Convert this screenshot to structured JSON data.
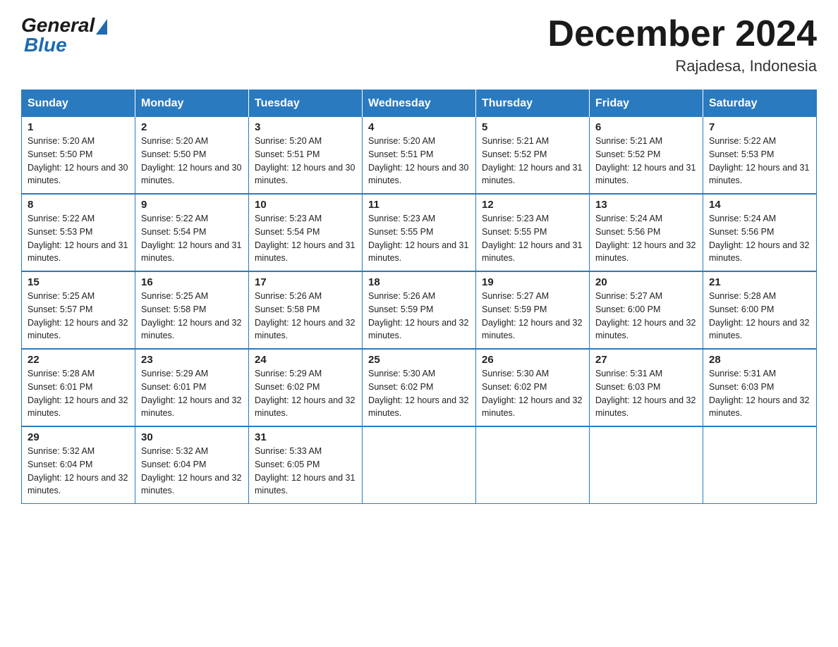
{
  "header": {
    "logo_general": "General",
    "logo_blue": "Blue",
    "month_title": "December 2024",
    "location": "Rajadesa, Indonesia"
  },
  "calendar": {
    "days_of_week": [
      "Sunday",
      "Monday",
      "Tuesday",
      "Wednesday",
      "Thursday",
      "Friday",
      "Saturday"
    ],
    "weeks": [
      [
        {
          "day": "1",
          "sunrise": "5:20 AM",
          "sunset": "5:50 PM",
          "daylight": "12 hours and 30 minutes."
        },
        {
          "day": "2",
          "sunrise": "5:20 AM",
          "sunset": "5:50 PM",
          "daylight": "12 hours and 30 minutes."
        },
        {
          "day": "3",
          "sunrise": "5:20 AM",
          "sunset": "5:51 PM",
          "daylight": "12 hours and 30 minutes."
        },
        {
          "day": "4",
          "sunrise": "5:20 AM",
          "sunset": "5:51 PM",
          "daylight": "12 hours and 30 minutes."
        },
        {
          "day": "5",
          "sunrise": "5:21 AM",
          "sunset": "5:52 PM",
          "daylight": "12 hours and 31 minutes."
        },
        {
          "day": "6",
          "sunrise": "5:21 AM",
          "sunset": "5:52 PM",
          "daylight": "12 hours and 31 minutes."
        },
        {
          "day": "7",
          "sunrise": "5:22 AM",
          "sunset": "5:53 PM",
          "daylight": "12 hours and 31 minutes."
        }
      ],
      [
        {
          "day": "8",
          "sunrise": "5:22 AM",
          "sunset": "5:53 PM",
          "daylight": "12 hours and 31 minutes."
        },
        {
          "day": "9",
          "sunrise": "5:22 AM",
          "sunset": "5:54 PM",
          "daylight": "12 hours and 31 minutes."
        },
        {
          "day": "10",
          "sunrise": "5:23 AM",
          "sunset": "5:54 PM",
          "daylight": "12 hours and 31 minutes."
        },
        {
          "day": "11",
          "sunrise": "5:23 AM",
          "sunset": "5:55 PM",
          "daylight": "12 hours and 31 minutes."
        },
        {
          "day": "12",
          "sunrise": "5:23 AM",
          "sunset": "5:55 PM",
          "daylight": "12 hours and 31 minutes."
        },
        {
          "day": "13",
          "sunrise": "5:24 AM",
          "sunset": "5:56 PM",
          "daylight": "12 hours and 32 minutes."
        },
        {
          "day": "14",
          "sunrise": "5:24 AM",
          "sunset": "5:56 PM",
          "daylight": "12 hours and 32 minutes."
        }
      ],
      [
        {
          "day": "15",
          "sunrise": "5:25 AM",
          "sunset": "5:57 PM",
          "daylight": "12 hours and 32 minutes."
        },
        {
          "day": "16",
          "sunrise": "5:25 AM",
          "sunset": "5:58 PM",
          "daylight": "12 hours and 32 minutes."
        },
        {
          "day": "17",
          "sunrise": "5:26 AM",
          "sunset": "5:58 PM",
          "daylight": "12 hours and 32 minutes."
        },
        {
          "day": "18",
          "sunrise": "5:26 AM",
          "sunset": "5:59 PM",
          "daylight": "12 hours and 32 minutes."
        },
        {
          "day": "19",
          "sunrise": "5:27 AM",
          "sunset": "5:59 PM",
          "daylight": "12 hours and 32 minutes."
        },
        {
          "day": "20",
          "sunrise": "5:27 AM",
          "sunset": "6:00 PM",
          "daylight": "12 hours and 32 minutes."
        },
        {
          "day": "21",
          "sunrise": "5:28 AM",
          "sunset": "6:00 PM",
          "daylight": "12 hours and 32 minutes."
        }
      ],
      [
        {
          "day": "22",
          "sunrise": "5:28 AM",
          "sunset": "6:01 PM",
          "daylight": "12 hours and 32 minutes."
        },
        {
          "day": "23",
          "sunrise": "5:29 AM",
          "sunset": "6:01 PM",
          "daylight": "12 hours and 32 minutes."
        },
        {
          "day": "24",
          "sunrise": "5:29 AM",
          "sunset": "6:02 PM",
          "daylight": "12 hours and 32 minutes."
        },
        {
          "day": "25",
          "sunrise": "5:30 AM",
          "sunset": "6:02 PM",
          "daylight": "12 hours and 32 minutes."
        },
        {
          "day": "26",
          "sunrise": "5:30 AM",
          "sunset": "6:02 PM",
          "daylight": "12 hours and 32 minutes."
        },
        {
          "day": "27",
          "sunrise": "5:31 AM",
          "sunset": "6:03 PM",
          "daylight": "12 hours and 32 minutes."
        },
        {
          "day": "28",
          "sunrise": "5:31 AM",
          "sunset": "6:03 PM",
          "daylight": "12 hours and 32 minutes."
        }
      ],
      [
        {
          "day": "29",
          "sunrise": "5:32 AM",
          "sunset": "6:04 PM",
          "daylight": "12 hours and 32 minutes."
        },
        {
          "day": "30",
          "sunrise": "5:32 AM",
          "sunset": "6:04 PM",
          "daylight": "12 hours and 32 minutes."
        },
        {
          "day": "31",
          "sunrise": "5:33 AM",
          "sunset": "6:05 PM",
          "daylight": "12 hours and 31 minutes."
        },
        null,
        null,
        null,
        null
      ]
    ]
  }
}
